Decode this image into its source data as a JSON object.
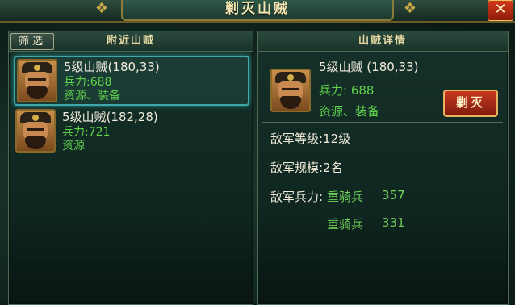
{
  "window": {
    "title": "剿灭山贼"
  },
  "header": {
    "close_icon": "close-icon",
    "close_glyph": "✕"
  },
  "left_panel": {
    "filter_label": "筛选",
    "title": "附近山贼",
    "items": [
      {
        "name": "5级山贼(180,33)",
        "troops": "兵力:688",
        "resources": "资源、装备",
        "selected": true
      },
      {
        "name": "5级山贼(182,28)",
        "troops": "兵力:721",
        "resources": "资源",
        "selected": false
      }
    ]
  },
  "right_panel": {
    "title": "山贼详情",
    "name": "5级山贼 (180,33)",
    "troops": "兵力: 688",
    "resources": "资源、装备",
    "annihilate_label": "剿灭",
    "enemy_level": "敌军等级:12级",
    "enemy_scale": "敌军规模:2名",
    "enemy_strength_label": "敌军兵力:",
    "units": [
      {
        "type": "重骑兵",
        "count": "357"
      },
      {
        "type": "重骑兵",
        "count": "331"
      }
    ]
  }
}
